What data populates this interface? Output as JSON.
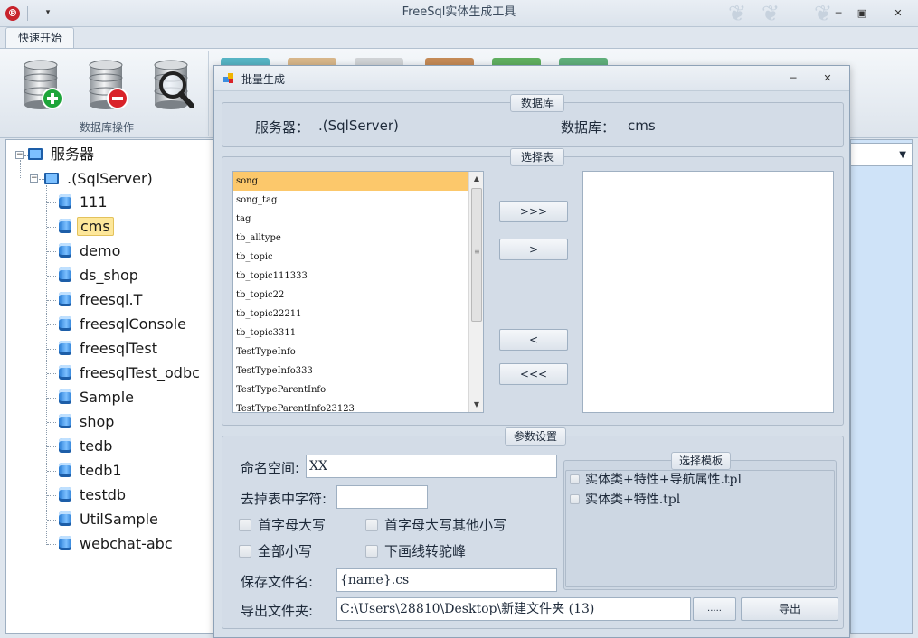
{
  "window": {
    "title": "FreeSql实体生成工具",
    "logo_glyph": "℗",
    "quick_access_glyph": "▾",
    "min_glyph": "─",
    "max_glyph": "▣",
    "close_glyph": "✕",
    "deco_glyph": "❦"
  },
  "ribbon": {
    "tab_label": "快速开始",
    "group_label": "数据库操作",
    "buttons": [
      "add-database",
      "remove-database",
      "query-database"
    ]
  },
  "tree": {
    "root": "服务器",
    "server": ".(SqlServer)",
    "databases": [
      "111",
      "cms",
      "demo",
      "ds_shop",
      "freesql.T",
      "freesqlConsole",
      "freesqlTest",
      "freesqlTest_odbc",
      "Sample",
      "shop",
      "tedb",
      "tedb1",
      "testdb",
      "UtilSample",
      "webchat-abc"
    ],
    "selected": "cms",
    "expander_glyph": "−"
  },
  "dialog": {
    "title": "批量生成",
    "min_glyph": "─",
    "close_glyph": "✕",
    "db_group": {
      "title": "数据库",
      "server_label": "服务器：",
      "server_value": ".(SqlServer)",
      "db_label": "数据库：",
      "db_value": "cms"
    },
    "table_group": {
      "title": "选择表",
      "tables": [
        "song",
        "song_tag",
        "tag",
        "tb_alltype",
        "tb_topic",
        "tb_topic111333",
        "tb_topic22",
        "tb_topic22211",
        "tb_topic3311",
        "TestTypeInfo",
        "TestTypeInfo333",
        "TestTypeParentInfo",
        "TestTypeParentInfo23123"
      ],
      "selected": "song",
      "add_all_label": ">>>",
      "add_label": ">",
      "remove_label": "<",
      "remove_all_label": "<<<",
      "scroll_up_glyph": "▲",
      "scroll_down_glyph": "▼",
      "scroll_grip_glyph": "≡"
    },
    "params_group": {
      "title": "参数设置",
      "namespace_label": "命名空间:",
      "namespace_value": "XX",
      "strip_label": "去掉表中字符:",
      "strip_value": "",
      "checkbox_first_upper": "首字母大写",
      "checkbox_first_upper_rest_lower": "首字母大写其他小写",
      "checkbox_all_lower": "全部小写",
      "checkbox_underscore_camel": "下画线转驼峰",
      "save_name_label": "保存文件名:",
      "save_name_value": "{name}.cs",
      "export_folder_label": "导出文件夹:",
      "export_folder_value": "C:\\Users\\28810\\Desktop\\新建文件夹 (13)",
      "browse_label": ".....",
      "export_label": "导出"
    },
    "template_group": {
      "title": "选择模板",
      "templates": [
        "实体类+特性+导航属性.tpl",
        "实体类+特性.tpl"
      ]
    }
  }
}
